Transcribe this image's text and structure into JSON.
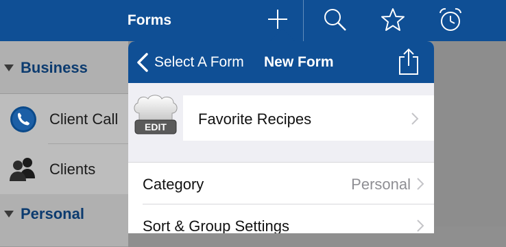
{
  "topbar": {
    "title": "Forms",
    "icons": [
      "add-icon",
      "search-icon",
      "star-icon",
      "alarm-clock-icon"
    ]
  },
  "sidebar": {
    "sections": [
      {
        "label": "Business",
        "items": [
          {
            "label": "Client Call",
            "icon": "phone-icon"
          },
          {
            "label": "Clients",
            "icon": "people-icon"
          }
        ]
      },
      {
        "label": "Personal",
        "items": []
      }
    ]
  },
  "popover": {
    "back_label": "Select A Form",
    "title": "New Form",
    "share_icon": "share-icon",
    "recipe": {
      "label": "Favorite Recipes",
      "icon": "chef-hat-icon",
      "badge": "EDIT"
    },
    "rows": [
      {
        "name": "Category",
        "value": "Personal"
      },
      {
        "name": "Sort & Group Settings",
        "value": ""
      }
    ]
  },
  "colors": {
    "nav_blue": "#0f4f95",
    "section_text": "#0c3b6f",
    "secondary_text": "#8e8e93"
  }
}
